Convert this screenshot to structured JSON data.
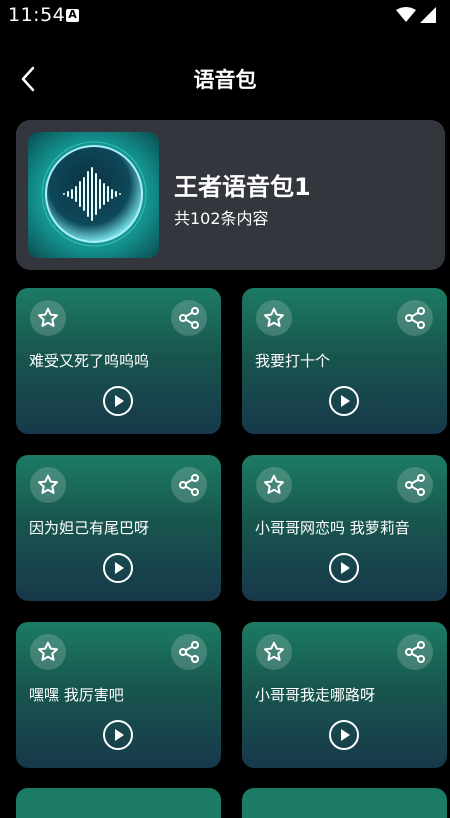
{
  "status_bar": {
    "time": "11:54",
    "notification_icon_letter": "A"
  },
  "header": {
    "title": "语音包"
  },
  "pack": {
    "name": "王者语音包1",
    "count_text": "共102条内容"
  },
  "clips": [
    {
      "label": "难受又死了呜呜呜"
    },
    {
      "label": "我要打十个"
    },
    {
      "label": "因为妲己有尾巴呀"
    },
    {
      "label": "小哥哥网恋吗 我萝莉音"
    },
    {
      "label": "嘿嘿 我厉害吧"
    },
    {
      "label": "小哥哥我走哪路呀"
    }
  ],
  "colors": {
    "background": "#000000",
    "card_top": "#1c7b64",
    "card_bottom": "#17384a",
    "pack_card": "#33363d"
  },
  "icons": [
    "back-arrow-icon",
    "star-icon",
    "share-icon",
    "play-icon",
    "wifi-icon",
    "signal-icon"
  ]
}
